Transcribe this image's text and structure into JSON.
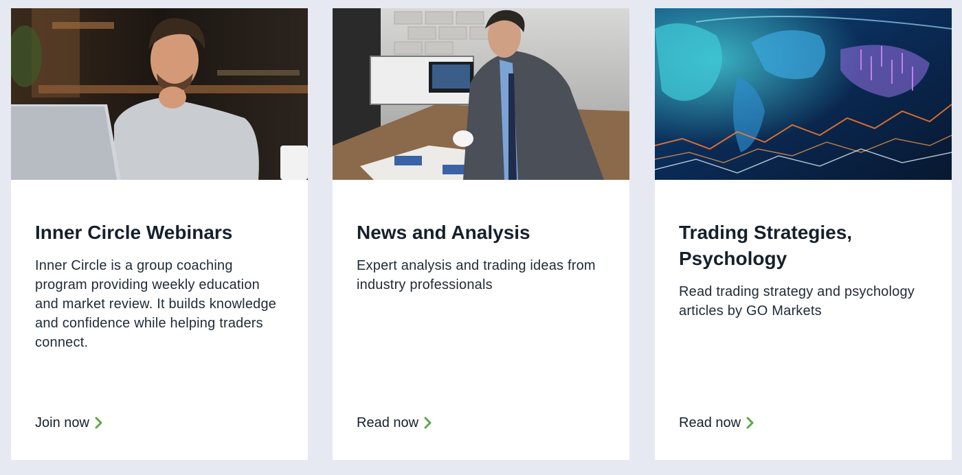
{
  "accent_color": "#5aa844",
  "cards": [
    {
      "image": "man-thinking-at-laptop-photo",
      "title": "Inner Circle Webinars",
      "description": "Inner Circle is a group coaching program providing weekly education and market review. It builds knowledge and confidence while helping traders connect.",
      "cta_label": "Join now",
      "cta_icon": "chevron-right-icon"
    },
    {
      "image": "businessman-reading-newspaper-photo",
      "title": "News and Analysis",
      "description": "Expert analysis and trading ideas from industry professionals",
      "cta_label": "Read now",
      "cta_icon": "chevron-right-icon"
    },
    {
      "image": "world-map-market-chart-photo",
      "title": "Trading Strategies, Psychology",
      "description": "Read trading strategy and psychology articles by GO Markets",
      "cta_label": "Read now",
      "cta_icon": "chevron-right-icon"
    }
  ]
}
